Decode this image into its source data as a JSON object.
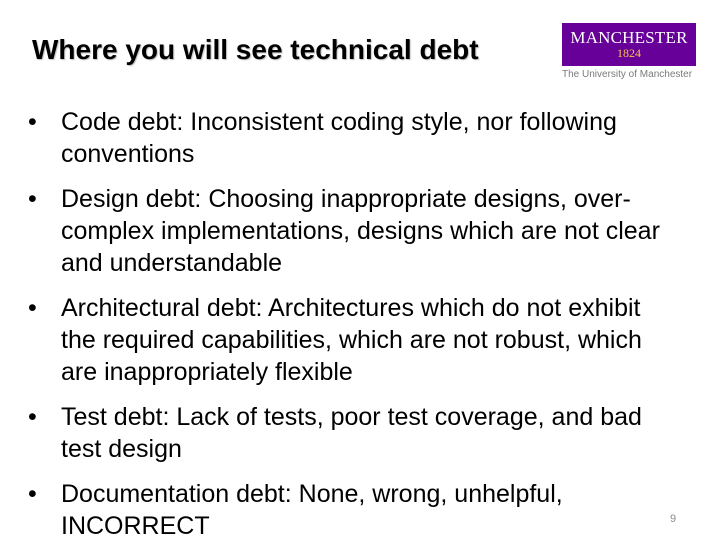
{
  "slide": {
    "title": "Where you will see technical debt",
    "page_number": "9"
  },
  "logo": {
    "word": "MANCHESTER",
    "year": "1824",
    "subtitle": "The University of Manchester",
    "color": "#660099",
    "year_color": "#f6c646"
  },
  "bullets": [
    {
      "icon": "bullet-dot",
      "text": "Code debt: Inconsistent coding style, nor following conventions"
    },
    {
      "icon": "bullet-dot",
      "text": "Design debt: Choosing inappropriate designs, over-complex implementations,  designs which are not clear and understandable"
    },
    {
      "icon": "bullet-dot",
      "text": "Architectural debt: Architectures which do not exhibit the required capabilities, which are not robust, which are inappropriately flexible"
    },
    {
      "icon": "bullet-dot",
      "text": "Test debt: Lack of tests, poor test coverage, and bad test design"
    },
    {
      "icon": "bullet-dot",
      "text": "Documentation debt: None, wrong, unhelpful, INCORRECT"
    }
  ]
}
